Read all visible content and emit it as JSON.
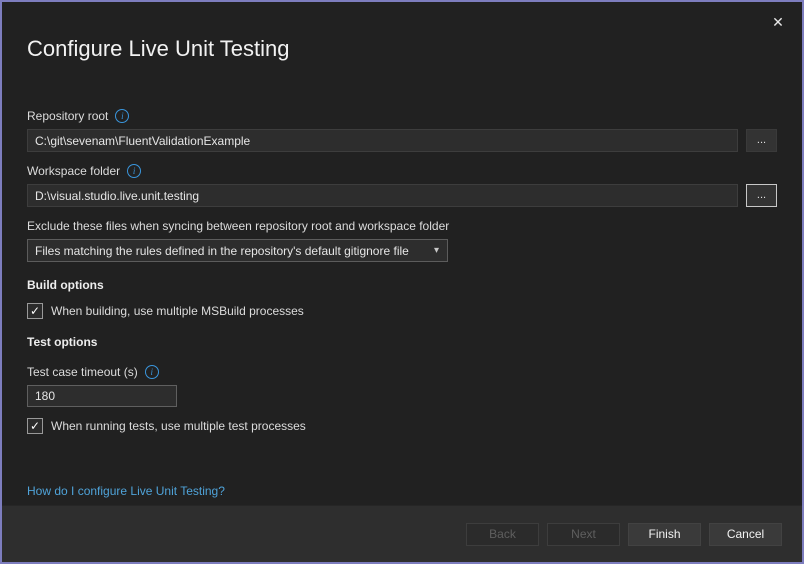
{
  "window": {
    "title": "Configure Live Unit Testing",
    "close_glyph": "✕"
  },
  "icons": {
    "info_glyph": "i",
    "caret_glyph": "▾",
    "check_glyph": "✓"
  },
  "fields": {
    "repository_root": {
      "label": "Repository root",
      "value": "C:\\git\\sevenam\\FluentValidationExample",
      "browse_label": "..."
    },
    "workspace_folder": {
      "label": "Workspace folder",
      "value": "D:\\visual.studio.live.unit.testing",
      "browse_label": "..."
    },
    "exclude": {
      "label": "Exclude these files when syncing between repository root and workspace folder",
      "selected_option": "Files matching the rules defined in the repository's default gitignore file"
    }
  },
  "build_options": {
    "heading": "Build options",
    "msbuild_checkbox": {
      "label": "When building, use multiple MSBuild processes",
      "checked": true
    }
  },
  "test_options": {
    "heading": "Test options",
    "timeout_label": "Test case timeout (s)",
    "timeout_value": "180",
    "testproc_checkbox": {
      "label": "When running tests, use multiple test processes",
      "checked": true
    }
  },
  "help_link": "How do I configure Live Unit Testing?",
  "footer": {
    "buttons": [
      {
        "label": "Back",
        "enabled": false
      },
      {
        "label": "Next",
        "enabled": false
      },
      {
        "label": "Finish",
        "enabled": true
      },
      {
        "label": "Cancel",
        "enabled": true
      }
    ]
  },
  "colors": {
    "accent_border": "#7d7dbe",
    "dialog_background": "#212121",
    "footer_background": "#2e2e2e",
    "info_icon_blue": "#3a96dd",
    "link_blue": "#4fa3d9"
  }
}
